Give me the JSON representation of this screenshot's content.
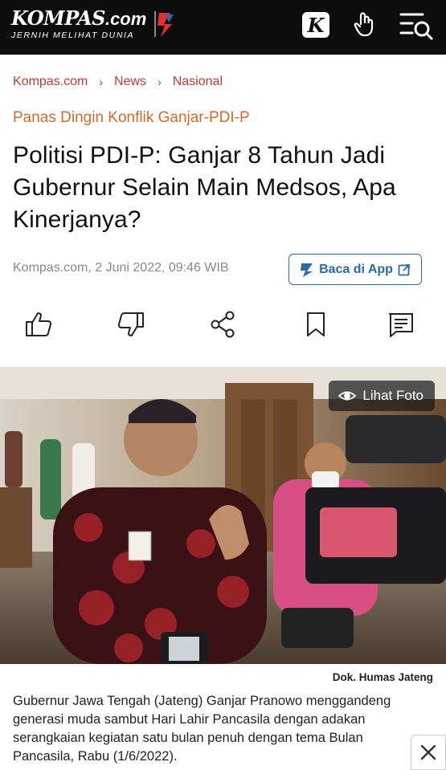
{
  "header": {
    "logo_text": "KOMPAS",
    "logo_suffix": ".com",
    "tagline": "JERNIH MELIHAT DUNIA",
    "k_button_label": "K",
    "icons": [
      "kompas-k-icon",
      "hand-icon",
      "menu-search-icon"
    ],
    "background_color": "#0d0d0d"
  },
  "breadcrumb": {
    "items": [
      "Kompas.com",
      "News",
      "Nasional"
    ],
    "separator": "›",
    "color": "#c5392b"
  },
  "article": {
    "kicker": "Panas Dingin Konflik Ganjar-PDI-P",
    "title": "Politisi PDI-P: Ganjar 8 Tahun Jadi Gubernur Selain Main Medsos, Apa Kinerjanya?",
    "meta": "Kompas.com, 2 Juni 2022, 09:46 WIB",
    "app_button_label": "Baca di App",
    "kicker_color": "#d06a2b"
  },
  "actions": [
    "like-icon",
    "dislike-icon",
    "share-icon",
    "bookmark-icon",
    "comment-icon"
  ],
  "photo": {
    "view_label": "Lihat Foto",
    "credit": "Dok. Humas Jateng",
    "caption": "Gubernur Jawa Tengah (Jateng) Ganjar Pranowo menggandeng generasi muda sambut Hari Lahir Pancasila dengan adakan serangkaian kegiatan satu bulan penuh dengan tema Bulan Pancasila, Rabu (1/6/2022)."
  },
  "close_icon": "close-icon"
}
